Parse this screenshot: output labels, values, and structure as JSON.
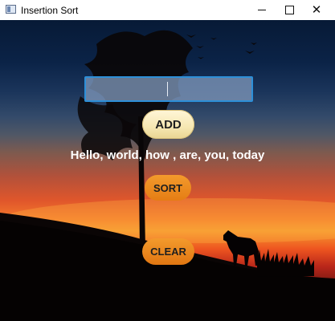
{
  "window": {
    "title": "Insertion Sort",
    "controls": {
      "minimize": "minimize",
      "maximize": "maximize",
      "close": "✕"
    }
  },
  "form": {
    "input_value": "",
    "input_placeholder": "",
    "add_label": "ADD",
    "sort_label": "SORT",
    "clear_label": "CLEAR",
    "output_text": "Hello, world, how , are, you, today"
  },
  "colors": {
    "input_border": "#2d8fd8",
    "add_button": "#f6e7b2",
    "sort_button": "#e98419",
    "clear_button": "#e98419"
  },
  "icons": {
    "app": "window-app-icon",
    "minimize": "minimize-icon",
    "maximize": "maximize-icon",
    "close": "close-icon"
  }
}
